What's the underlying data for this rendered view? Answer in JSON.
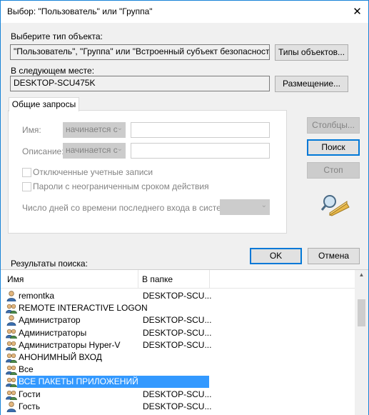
{
  "window": {
    "title": "Выбор: \"Пользователь\" или \"Группа\"",
    "close_glyph": "✕"
  },
  "object_type": {
    "label": "Выберите тип объекта:",
    "value": "\"Пользователь\", \"Группа\" или \"Встроенный субъект безопасности\"",
    "button": "Типы объектов..."
  },
  "location": {
    "label": "В следующем месте:",
    "value": "DESKTOP-SCU475K",
    "button": "Размещение..."
  },
  "tab": {
    "label": "Общие запросы"
  },
  "query": {
    "name_label": "Имя:",
    "name_op": "начинается с",
    "desc_label": "Описание:",
    "desc_op": "начинается с",
    "disabled_accounts": "Отключенные учетные записи",
    "no_expire_pw": "Пароли с неограниченным сроком действия",
    "days_label": "Число дней со времени последнего входа в систему:"
  },
  "side_buttons": {
    "columns": "Столбцы...",
    "search": "Поиск",
    "stop": "Стоп"
  },
  "dialog_buttons": {
    "ok": "OK",
    "cancel": "Отмена"
  },
  "results": {
    "label": "Результаты поиска:",
    "columns": [
      "Имя",
      "В папке"
    ],
    "rows": [
      {
        "name": "remontka",
        "folder": "DESKTOP-SCU...",
        "icon": "user-icon"
      },
      {
        "name": "REMOTE INTERACTIVE LOGON",
        "folder": "",
        "icon": "group-icon"
      },
      {
        "name": "Администратор",
        "folder": "DESKTOP-SCU...",
        "icon": "user-icon"
      },
      {
        "name": "Администраторы",
        "folder": "DESKTOP-SCU...",
        "icon": "group-icon"
      },
      {
        "name": "Администраторы Hyper-V",
        "folder": "DESKTOP-SCU...",
        "icon": "group-icon"
      },
      {
        "name": "АНОНИМНЫЙ ВХОД",
        "folder": "",
        "icon": "group-icon"
      },
      {
        "name": "Все",
        "folder": "",
        "icon": "group-icon"
      },
      {
        "name": "ВСЕ ПАКЕТЫ ПРИЛОЖЕНИЙ",
        "folder": "",
        "icon": "group-icon",
        "selected": true
      },
      {
        "name": "Гости",
        "folder": "DESKTOP-SCU...",
        "icon": "group-icon"
      },
      {
        "name": "Гость",
        "folder": "DESKTOP-SCU...",
        "icon": "user-icon"
      }
    ]
  },
  "colors": {
    "accent": "#0078d7",
    "selection": "#3399ff",
    "window_border": "#1883d7"
  }
}
